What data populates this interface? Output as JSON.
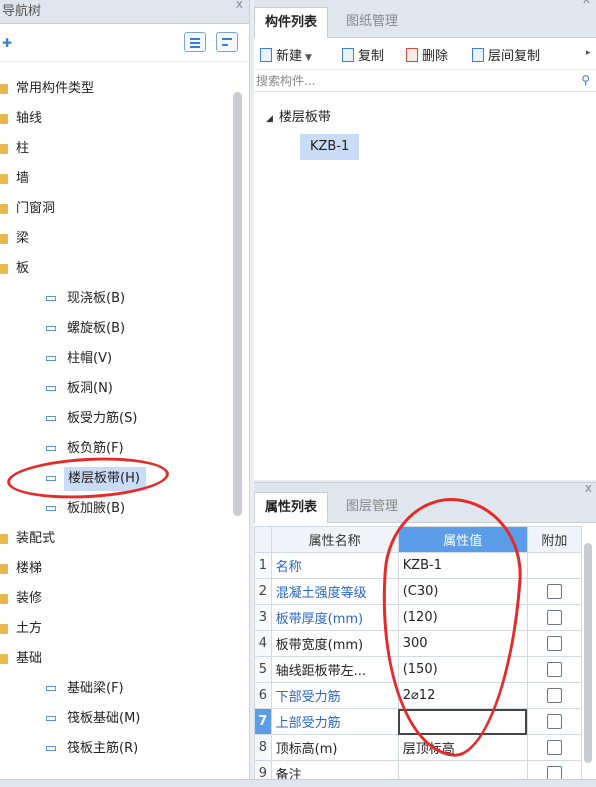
{
  "left_panel": {
    "title": "导航树",
    "close": "x",
    "tree": [
      {
        "label": "常用构件类型",
        "type": "folder"
      },
      {
        "label": "轴线",
        "type": "folder"
      },
      {
        "label": "柱",
        "type": "folder"
      },
      {
        "label": "墙",
        "type": "folder"
      },
      {
        "label": "门窗洞",
        "type": "folder"
      },
      {
        "label": "梁",
        "type": "folder"
      },
      {
        "label": "板",
        "type": "folder"
      },
      {
        "label": "现浇板(B)",
        "type": "child",
        "icon": "slab-icon"
      },
      {
        "label": "螺旋板(B)",
        "type": "child",
        "icon": "spiral-slab-icon"
      },
      {
        "label": "柱帽(V)",
        "type": "child",
        "icon": "column-cap-icon"
      },
      {
        "label": "板洞(N)",
        "type": "child",
        "icon": "slab-hole-icon"
      },
      {
        "label": "板受力筋(S)",
        "type": "child",
        "icon": "slab-rebar-icon"
      },
      {
        "label": "板负筋(F)",
        "type": "child",
        "icon": "negative-rebar-icon"
      },
      {
        "label": "楼层板带(H)",
        "type": "child",
        "icon": "floor-strip-icon",
        "selected": true
      },
      {
        "label": "板加腋(B)",
        "type": "child",
        "icon": "slab-haunch-icon"
      },
      {
        "label": "装配式",
        "type": "folder"
      },
      {
        "label": "楼梯",
        "type": "folder"
      },
      {
        "label": "装修",
        "type": "folder"
      },
      {
        "label": "土方",
        "type": "folder"
      },
      {
        "label": "基础",
        "type": "folder"
      },
      {
        "label": "基础梁(F)",
        "type": "child",
        "icon": "foundation-beam-icon"
      },
      {
        "label": "筏板基础(M)",
        "type": "child",
        "icon": "raft-foundation-icon"
      },
      {
        "label": "筏板主筋(R)",
        "type": "child",
        "icon": "raft-main-rebar-icon"
      }
    ]
  },
  "component_panel": {
    "tabs": [
      {
        "label": "构件列表",
        "active": true
      },
      {
        "label": "图纸管理",
        "active": false
      }
    ],
    "toolbar": {
      "new": "新建",
      "copy": "复制",
      "delete": "删除",
      "floor_copy": "层间复制"
    },
    "search_placeholder": "搜索构件...",
    "group": "楼层板带",
    "selected_item": "KZB-1"
  },
  "property_panel": {
    "tabs": [
      {
        "label": "属性列表",
        "active": true
      },
      {
        "label": "图层管理",
        "active": false
      }
    ],
    "columns": [
      "属性名称",
      "属性值",
      "附加"
    ],
    "rows": [
      {
        "num": "1",
        "name": "名称",
        "value": "KZB-1",
        "blue": true,
        "checkbox": false
      },
      {
        "num": "2",
        "name": "混凝土强度等级",
        "value": "(C30)",
        "blue": true,
        "checkbox": true
      },
      {
        "num": "3",
        "name": "板带厚度(mm)",
        "value": "(120)",
        "blue": true,
        "checkbox": true
      },
      {
        "num": "4",
        "name": "板带宽度(mm)",
        "value": "300",
        "blue": false,
        "checkbox": true
      },
      {
        "num": "5",
        "name": "轴线距板带左...",
        "value": "(150)",
        "blue": false,
        "checkbox": true
      },
      {
        "num": "6",
        "name": "下部受力筋",
        "value": "2⌀12",
        "blue": true,
        "checkbox": true
      },
      {
        "num": "7",
        "name": "上部受力筋",
        "value": "",
        "blue": true,
        "checkbox": true,
        "current": true
      },
      {
        "num": "8",
        "name": "顶标高(m)",
        "value": "层顶标高",
        "blue": false,
        "checkbox": true
      },
      {
        "num": "9",
        "name": "备注",
        "value": "",
        "blue": false,
        "checkbox": true
      }
    ]
  },
  "colors": {
    "annotation": "#e62a2a",
    "selection": "#c9dcf6",
    "header_highlight": "#5b9de8",
    "blue_text": "#2a67c7"
  }
}
